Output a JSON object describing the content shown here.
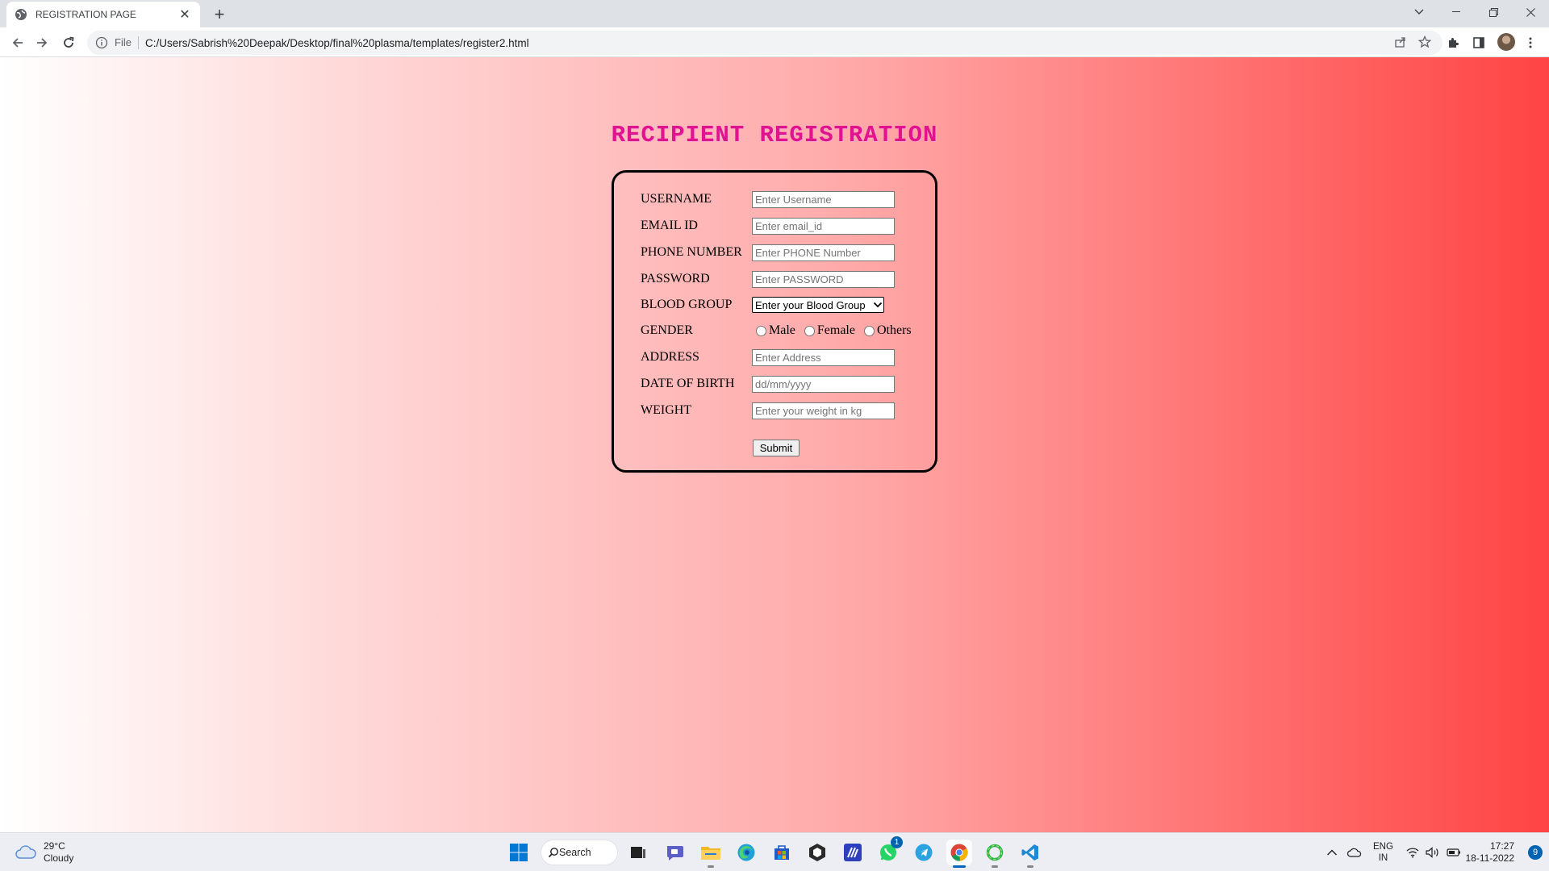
{
  "browser": {
    "tab_title": "REGISTRATION PAGE",
    "url_scheme_label": "File",
    "url": "C:/Users/Sabrish%20Deepak/Desktop/final%20plasma/templates/register2.html"
  },
  "page": {
    "title": "RECIPIENT REGISTRATION",
    "fields": [
      {
        "label": "USERNAME",
        "placeholder": "Enter Username"
      },
      {
        "label": "EMAIL ID",
        "placeholder": "Enter email_id"
      },
      {
        "label": "PHONE NUMBER",
        "placeholder": "Enter PHONE Number"
      },
      {
        "label": "PASSWORD",
        "placeholder": "Enter PASSWORD"
      }
    ],
    "blood_group": {
      "label": "BLOOD GROUP",
      "selected": "Enter your Blood Group"
    },
    "gender": {
      "label": "GENDER",
      "options": [
        "Male",
        "Female",
        "Others"
      ]
    },
    "fields2": [
      {
        "label": "ADDRESS",
        "placeholder": "Enter Address"
      },
      {
        "label": "DATE OF BIRTH",
        "placeholder": "dd/mm/yyyy"
      },
      {
        "label": "WEIGHT",
        "placeholder": "Enter your weight in kg"
      }
    ],
    "submit_label": "Submit"
  },
  "taskbar": {
    "weather": {
      "temp": "29°C",
      "condition": "Cloudy"
    },
    "search_label": "Search",
    "whatsapp_badge": "1",
    "lang": {
      "line1": "ENG",
      "line2": "IN"
    },
    "time": "17:27",
    "date": "18-11-2022",
    "notification_count": "9"
  },
  "colors": {
    "title": "#e0128e",
    "gradient_start": "#ffffff",
    "gradient_end": "#ff4444"
  }
}
